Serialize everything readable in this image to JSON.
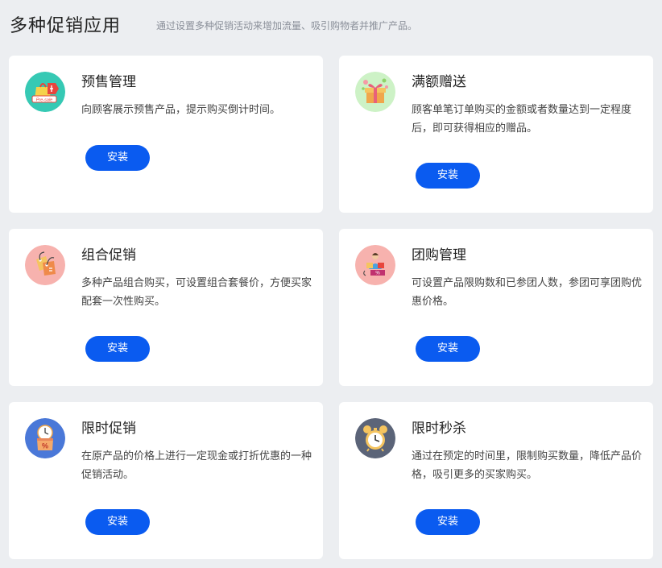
{
  "header": {
    "title": "多种促销应用",
    "subtitle": "通过设置多种促销活动来增加流量、吸引购物者并推广产品。"
  },
  "cards": [
    {
      "title": "预售管理",
      "description": "向顾客展示预售产品，提示购买倒计时间。",
      "button_label": "安装",
      "icon": "pre-sale-icon",
      "icon_bg": "#36c9b4",
      "icon_text": "Pre-sale"
    },
    {
      "title": "满额赠送",
      "description": "顾客单笔订单购买的金额或者数量达到一定程度后，即可获得相应的赠品。",
      "button_label": "安装",
      "icon": "gift-box-icon",
      "icon_bg": "#cdf2c6"
    },
    {
      "title": "组合促销",
      "description": "多种产品组合购买，可设置组合套餐价，方便买家配套一次性购买。",
      "button_label": "安装",
      "icon": "price-tags-icon",
      "icon_bg": "#f7b2ae"
    },
    {
      "title": "团购管理",
      "description": "可设置产品限购数和已参团人数，参团可享团购优惠价格。",
      "button_label": "安装",
      "icon": "group-buy-icon",
      "icon_bg": "#f7b2ae"
    },
    {
      "title": "限时促销",
      "description": "在原产品的价格上进行一定现金或打折优惠的一种促销活动。",
      "button_label": "安装",
      "icon": "discount-clock-icon",
      "icon_bg": "#4a78d8"
    },
    {
      "title": "限时秒杀",
      "description": "通过在预定的时间里，限制购买数量，降低产品价格，吸引更多的买家购买。",
      "button_label": "安装",
      "icon": "alarm-clock-icon",
      "icon_bg": "#5b6478"
    }
  ],
  "colors": {
    "page_bg": "#eceef1",
    "card_bg": "#ffffff",
    "button_bg": "#0a5bf0",
    "button_text": "#ffffff"
  }
}
